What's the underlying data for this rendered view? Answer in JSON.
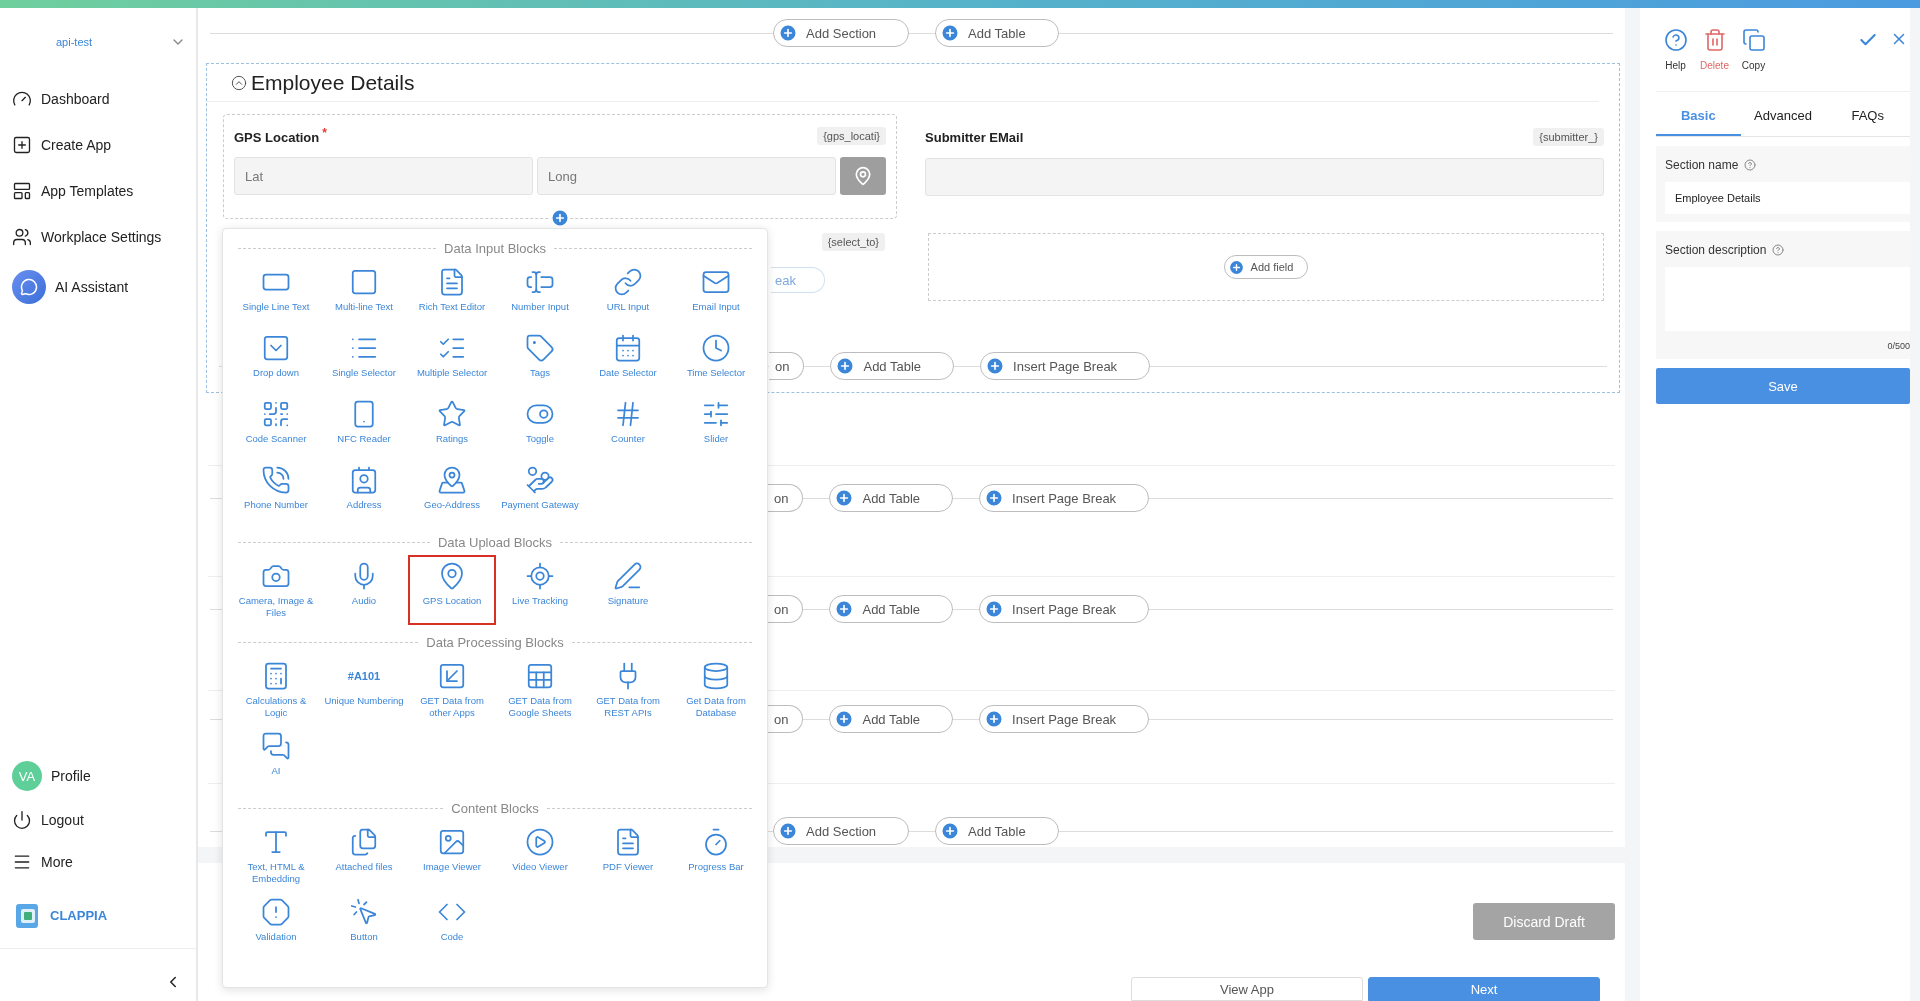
{
  "sidebar": {
    "workspace": "api-test",
    "nav": [
      "Dashboard",
      "Create App",
      "App Templates",
      "Workplace Settings"
    ],
    "assistant": "AI Assistant",
    "profile": {
      "initials": "VA",
      "label": "Profile"
    },
    "footer_items": [
      "Logout",
      "More"
    ],
    "brand": "CLAPPIA"
  },
  "canvas": {
    "top_actions": [
      "Add Section",
      "Add Table"
    ],
    "section": {
      "title": "Employee Details",
      "gps_field": {
        "label": "GPS Location",
        "required_mark": "*",
        "variable": "{gps_locati}",
        "inputs": [
          {
            "placeholder": "Lat"
          },
          {
            "placeholder": "Long"
          }
        ]
      },
      "email_field": {
        "label": "Submitter EMail",
        "variable": "{submitter_}"
      },
      "hidden_field": {
        "variable": "{select_to}",
        "faded_action": "eak"
      },
      "add_field": "Add field",
      "actions": [
        "on",
        "Add Table",
        "Insert Page Break"
      ]
    },
    "empty_rows": [
      {
        "actions": [
          "on",
          "Add Table",
          "Insert Page Break"
        ]
      },
      {
        "actions": [
          "on",
          "Add Table",
          "Insert Page Break"
        ]
      },
      {
        "actions": [
          "on",
          "Add Table",
          "Insert Page Break"
        ]
      }
    ],
    "bottom_actions": [
      "Add Section",
      "Add Table"
    ],
    "footer": {
      "discard": "Discard Draft",
      "view": "View App",
      "next": "Next"
    }
  },
  "block_picker": {
    "groups": [
      {
        "title": "Data Input Blocks",
        "items": [
          {
            "label": "Single Line Text",
            "selected": false
          },
          {
            "label": "Multi-line Text",
            "selected": false
          },
          {
            "label": "Rich Text Editor",
            "selected": false
          },
          {
            "label": "Number Input",
            "selected": false
          },
          {
            "label": "URL Input",
            "selected": false
          },
          {
            "label": "Email Input",
            "selected": false
          },
          {
            "label": "Drop down",
            "selected": false
          },
          {
            "label": "Single Selector",
            "selected": false
          },
          {
            "label": "Multiple Selector",
            "selected": false
          },
          {
            "label": "Tags",
            "selected": false
          },
          {
            "label": "Date Selector",
            "selected": false
          },
          {
            "label": "Time Selector",
            "selected": false
          },
          {
            "label": "Code Scanner",
            "selected": false
          },
          {
            "label": "NFC Reader",
            "selected": false
          },
          {
            "label": "Ratings",
            "selected": false
          },
          {
            "label": "Toggle",
            "selected": false
          },
          {
            "label": "Counter",
            "selected": false
          },
          {
            "label": "Slider",
            "selected": false
          },
          {
            "label": "Phone Number",
            "selected": false
          },
          {
            "label": "Address",
            "selected": false
          },
          {
            "label": "Geo-Address",
            "selected": false
          },
          {
            "label": "Payment Gateway",
            "selected": false
          }
        ]
      },
      {
        "title": "Data Upload Blocks",
        "items": [
          {
            "label": "Camera, Image & Files",
            "selected": false
          },
          {
            "label": "Audio",
            "selected": false
          },
          {
            "label": "GPS Location",
            "selected": true
          },
          {
            "label": "Live Tracking",
            "selected": false
          },
          {
            "label": "Signature",
            "selected": false
          }
        ]
      },
      {
        "title": "Data Processing Blocks",
        "items": [
          {
            "label": "Calculations & Logic",
            "selected": false
          },
          {
            "label": "Unique Numbering",
            "selected": false,
            "badge": "#A101"
          },
          {
            "label": "GET Data from other Apps",
            "selected": false
          },
          {
            "label": "GET Data from Google Sheets",
            "selected": false
          },
          {
            "label": "GET Data from REST APIs",
            "selected": false
          },
          {
            "label": "Get Data from Database",
            "selected": false
          },
          {
            "label": "AI",
            "selected": false
          }
        ]
      },
      {
        "title": "Content Blocks",
        "items": [
          {
            "label": "Text, HTML & Embedding",
            "selected": false
          },
          {
            "label": "Attached files",
            "selected": false
          },
          {
            "label": "Image Viewer",
            "selected": false
          },
          {
            "label": "Video Viewer",
            "selected": false
          },
          {
            "label": "PDF Viewer",
            "selected": false
          },
          {
            "label": "Progress Bar",
            "selected": false
          },
          {
            "label": "Validation",
            "selected": false
          },
          {
            "label": "Button",
            "selected": false
          },
          {
            "label": "Code",
            "selected": false
          }
        ]
      }
    ]
  },
  "properties": {
    "tools": [
      {
        "label": "Help",
        "kind": "help"
      },
      {
        "label": "Delete",
        "kind": "delete"
      },
      {
        "label": "Copy",
        "kind": "copy"
      }
    ],
    "tabs": [
      {
        "label": "Basic",
        "selected": true
      },
      {
        "label": "Advanced",
        "selected": false
      },
      {
        "label": "FAQs",
        "selected": false
      }
    ],
    "name_label": "Section name",
    "name_value": "Employee Details",
    "description_label": "Section description",
    "counter": "0/500",
    "save": "Save"
  }
}
